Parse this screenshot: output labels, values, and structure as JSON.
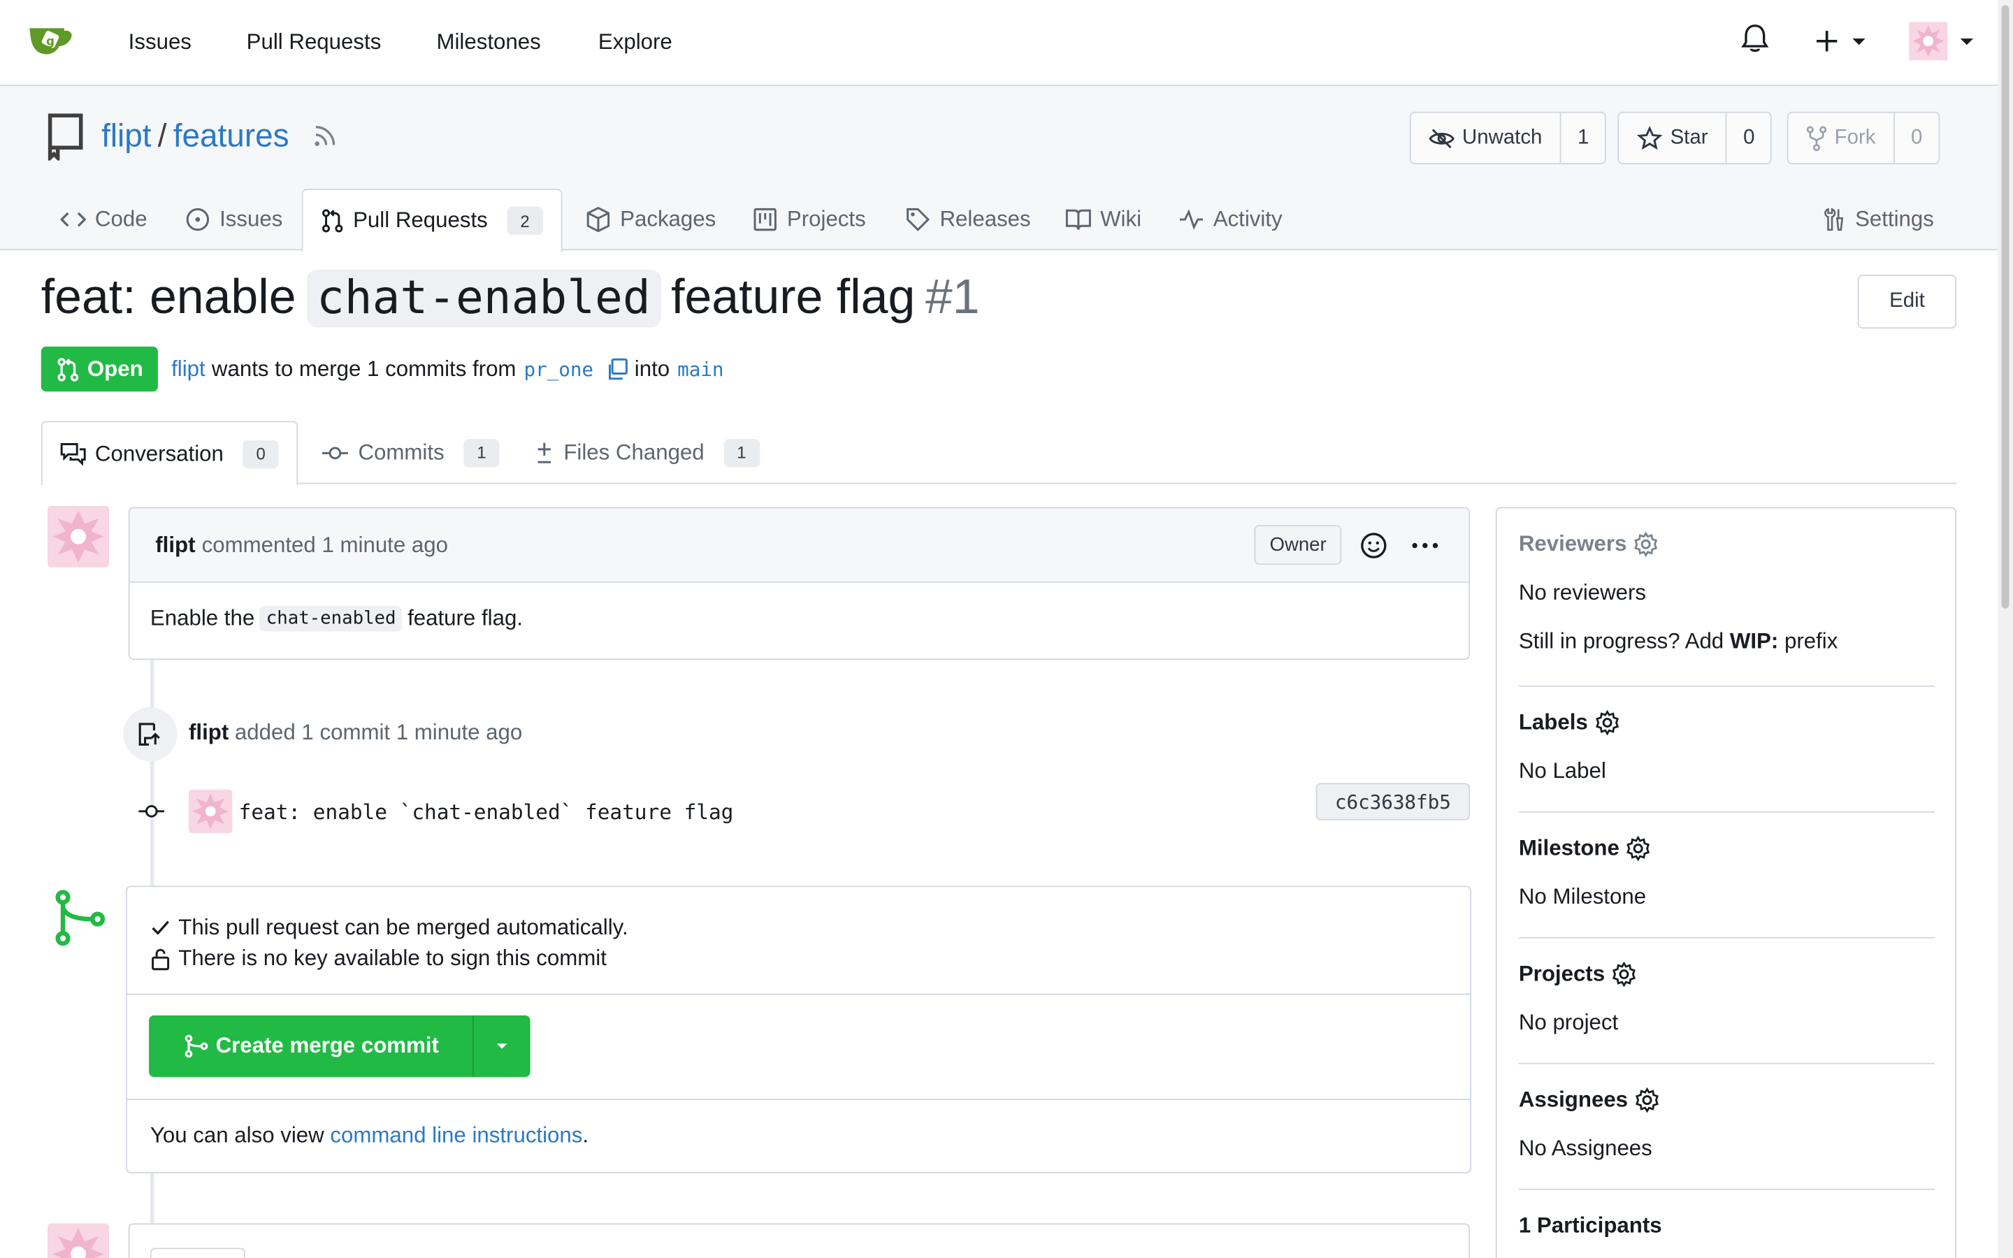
{
  "navbar": {
    "items": [
      "Issues",
      "Pull Requests",
      "Milestones",
      "Explore"
    ]
  },
  "repo": {
    "owner": "flipt",
    "name": "features",
    "unwatch_label": "Unwatch",
    "watch_count": "1",
    "star_label": "Star",
    "star_count": "0",
    "fork_label": "Fork",
    "fork_count": "0"
  },
  "tabs": {
    "code": "Code",
    "issues": "Issues",
    "pull_requests": "Pull Requests",
    "pull_requests_count": "2",
    "packages": "Packages",
    "projects": "Projects",
    "releases": "Releases",
    "wiki": "Wiki",
    "activity": "Activity",
    "settings": "Settings"
  },
  "pr": {
    "title_prefix": "feat: enable",
    "title_code": "chat-enabled",
    "title_suffix": "feature flag",
    "number": "#1",
    "edit_label": "Edit",
    "status": "Open",
    "author": "flipt",
    "merge_text": "wants to merge 1 commits from",
    "head_branch": "pr_one",
    "into_text": "into",
    "base_branch": "main"
  },
  "pr_tabs": {
    "conversation": "Conversation",
    "conversation_count": "0",
    "commits": "Commits",
    "commits_count": "1",
    "files": "Files Changed",
    "files_count": "1"
  },
  "comment": {
    "author": "flipt",
    "meta": "commented 1 minute ago",
    "role": "Owner",
    "body_prefix": "Enable the",
    "body_code": "chat-enabled",
    "body_suffix": "feature flag."
  },
  "event": {
    "author": "flipt",
    "text": "added 1 commit 1 minute ago",
    "commit_message": "feat: enable `chat-enabled` feature flag",
    "commit_sha": "c6c3638fb5"
  },
  "merge": {
    "status": "This pull request can be merged automatically.",
    "sign_note": "There is no key available to sign this commit",
    "button_label": "Create merge commit",
    "cli_prefix": "You can also view",
    "cli_link": "command line instructions",
    "cli_suffix": "."
  },
  "sidebar": {
    "reviewers_title": "Reviewers",
    "reviewers_value": "No reviewers",
    "wip_prefix": "Still in progress? Add",
    "wip_bold": "WIP:",
    "wip_suffix": "prefix",
    "labels_title": "Labels",
    "labels_value": "No Label",
    "milestone_title": "Milestone",
    "milestone_value": "No Milestone",
    "projects_title": "Projects",
    "projects_value": "No project",
    "assignees_title": "Assignees",
    "assignees_value": "No Assignees",
    "participants_title": "1 Participants"
  },
  "colors": {
    "accent": "#2a7ac4",
    "success": "#21ba45",
    "border": "#d0d7de"
  }
}
